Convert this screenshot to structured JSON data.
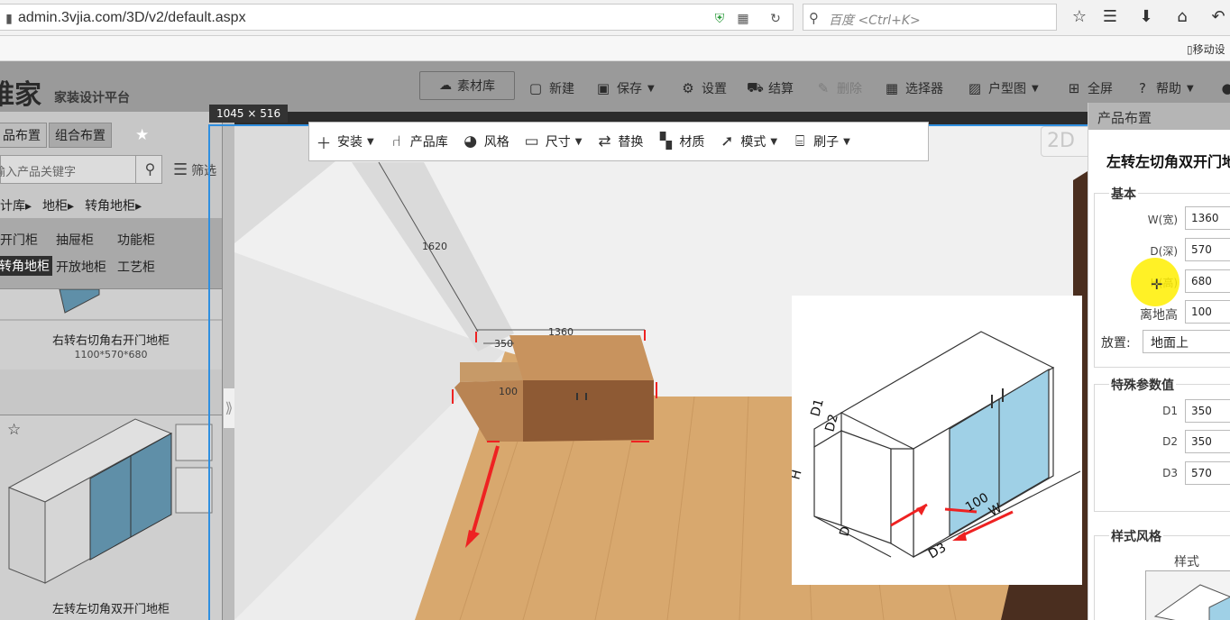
{
  "browser": {
    "url": "admin.3vjia.com/3D/v2/default.aspx",
    "search_placeholder": "百度 <Ctrl+K>",
    "bookmark_mobile": "移动设"
  },
  "header": {
    "logo": "维家",
    "slogan": "家装设计平台",
    "buttons": {
      "material": "素材库",
      "new": "新建",
      "save": "保存",
      "settings": "设置",
      "checkout": "结算",
      "delete": "删除",
      "selector": "选择器",
      "floorplan": "户型图",
      "fullscreen": "全屏",
      "help": "帮助"
    }
  },
  "left_panel": {
    "tabs": [
      "品布置",
      "组合布置"
    ],
    "search_placeholder": "输入产品关键字",
    "filter_label": "筛选",
    "breadcrumb": [
      "计库",
      "地柜",
      "转角地柜"
    ],
    "categories": [
      "开门柜",
      "抽屉柜",
      "功能柜",
      "转角地柜",
      "开放地柜",
      "工艺柜"
    ],
    "products": [
      {
        "name": "右转右切角右开门地柜",
        "size": "1100*570*680"
      },
      {
        "name": "左转左切角双开门地柜",
        "size": ""
      }
    ]
  },
  "viewport": {
    "size_tag": "1045 × 516",
    "corner_label": "2D",
    "dimensions": {
      "height_line": "1620",
      "width_line": "1360",
      "d_line": "350",
      "offset": "100"
    }
  },
  "toolbar": {
    "install": "安装",
    "library": "产品库",
    "style": "风格",
    "size": "尺寸",
    "replace": "替换",
    "material": "材质",
    "mode": "模式",
    "brush": "刷子"
  },
  "diagram": {
    "labels": [
      "D1",
      "D2",
      "D3",
      "H",
      "D",
      "W",
      "100"
    ]
  },
  "right_panel": {
    "header": "产品布置",
    "title": "左转左切角双开门地",
    "basic": {
      "legend": "基本",
      "fields": [
        {
          "label": "W(宽)",
          "value": "1360"
        },
        {
          "label": "D(深)",
          "value": "570"
        },
        {
          "label": "H(高)",
          "value": "680"
        },
        {
          "label": "离地高",
          "value": "100"
        }
      ],
      "placement_label": "放置:",
      "placement_value": "地面上"
    },
    "special": {
      "legend": "特殊参数值",
      "fields": [
        {
          "label": "D1",
          "value": "350"
        },
        {
          "label": "D2",
          "value": "350"
        },
        {
          "label": "D3",
          "value": "570"
        }
      ]
    },
    "style": {
      "legend": "样式风格",
      "sub": "样式"
    }
  }
}
